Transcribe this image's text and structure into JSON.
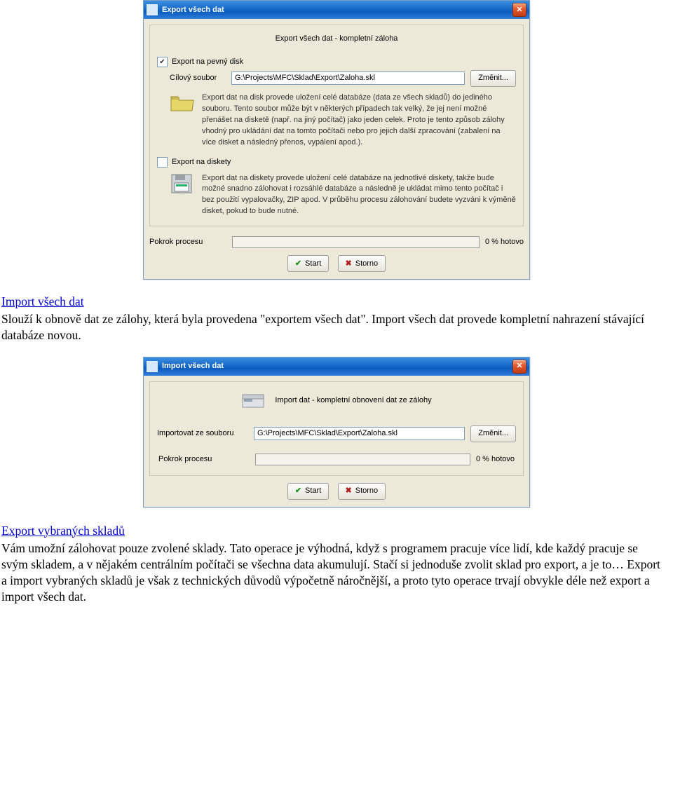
{
  "export_dialog": {
    "title": "Export všech dat",
    "heading": "Export všech dat - kompletní záloha",
    "chk_disk": "Export na pevný disk",
    "target_file_label": "Cílový soubor",
    "target_file_value": "G:\\Projects\\MFC\\Sklad\\Export\\Zaloha.skl",
    "change_btn": "Změnit...",
    "disk_desc": "Export dat na disk provede uložení celé databáze (data ze všech skladů) do jediného souboru. Tento soubor může být v některých případech tak velký, že jej není možné přenášet na disketě (např. na jiný počítač)  jako jeden celek. Proto je tento způsob zálohy vhodný pro ukládání dat na tomto počítači nebo pro jejich další zpracování (zabalení na více disket a následný přenos, vypálení  apod.).",
    "chk_floppy": "Export na diskety",
    "floppy_desc": "Export dat na diskety provede uložení celé databáze na jednotlivé diskety, takže bude možné snadno zálohovat i rozsáhlé databáze a následně je ukládat mimo tento počítač i bez použití vypalovačky, ZIP apod. V průběhu procesu zálohování budete vyzváni k výměně disket, pokud to bude nutné.",
    "progress_label": "Pokrok procesu",
    "pct": "0 % hotovo",
    "start_btn": "Start",
    "cancel_btn": "Storno"
  },
  "import_section": {
    "link": "Import všech dat",
    "para": "Slouží k obnově dat ze zálohy, která byla provedena \"exportem všech dat\". Import všech dat provede kompletní nahrazení stávající databáze novou."
  },
  "import_dialog": {
    "title": "Import všech dat",
    "heading": "Import dat - kompletní obnovení dat ze zálohy",
    "from_file_label": "Importovat ze souboru",
    "from_file_value": "G:\\Projects\\MFC\\Sklad\\Export\\Zaloha.skl",
    "change_btn": "Změnit...",
    "progress_label": "Pokrok procesu",
    "pct": "0 % hotovo",
    "start_btn": "Start",
    "cancel_btn": "Storno"
  },
  "export_selected_section": {
    "link": "Export vybraných skladů",
    "para": "Vám umožní zálohovat pouze zvolené sklady. Tato operace je výhodná, když s programem pracuje více lidí, kde každý pracuje se svým skladem, a v nějakém centrálním počítači se všechna data akumulují. Stačí si jednoduše zvolit sklad pro export, a je to… Export a import vybraných skladů je však z technických důvodů výpočetně náročnější, a proto tyto operace trvají obvykle déle než export a import všech dat."
  }
}
